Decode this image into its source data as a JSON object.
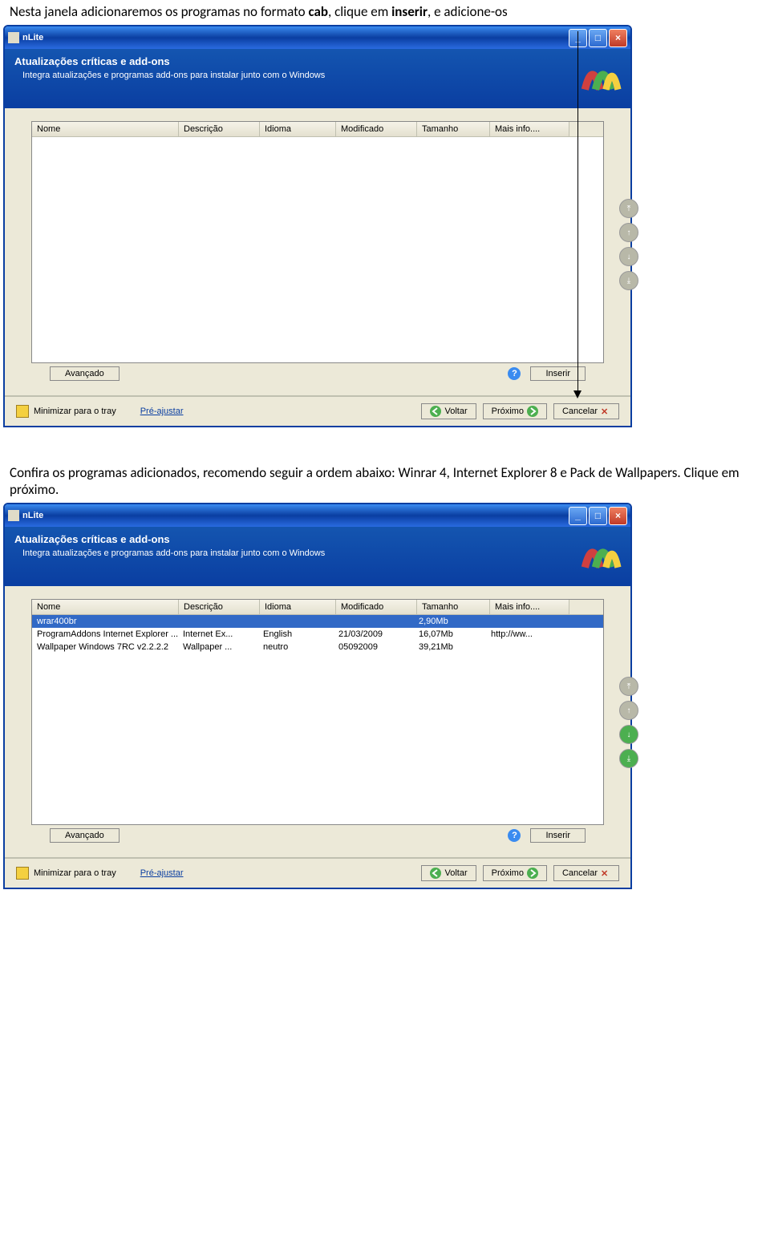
{
  "doc": {
    "intro_1a": "Nesta janela adicionaremos os programas no formato ",
    "intro_1b": "cab",
    "intro_1c": ", clique em ",
    "intro_1d": "inserir",
    "intro_1e": ", e adicione-os",
    "intro_2": "Confira os programas adicionados, recomendo seguir a ordem abaixo: Winrar 4, Internet Explorer 8 e Pack de Wallpapers. Clique em próximo."
  },
  "window": {
    "title": "nLite",
    "header_title": "Atualizações críticas e add-ons",
    "header_sub": "Integra atualizações e programas add-ons para instalar junto com o Windows",
    "cols": {
      "nome": "Nome",
      "desc": "Descrição",
      "idioma": "Idioma",
      "mod": "Modificado",
      "tam": "Tamanho",
      "mais": "Mais info...."
    },
    "buttons": {
      "avancado": "Avançado",
      "inserir": "Inserir",
      "voltar": "Voltar",
      "proximo": "Próximo",
      "cancelar": "Cancelar",
      "minimizar_tray": "Minimizar para o tray",
      "pre_ajustar": "Pré-ajustar"
    }
  },
  "rows": [
    {
      "nome": "wrar400br",
      "desc": "",
      "idioma": "",
      "mod": "",
      "tam": "2,90Mb",
      "mais": ""
    },
    {
      "nome": "ProgramAddons Internet Explorer ...",
      "desc": "Internet Ex...",
      "idioma": "English",
      "mod": "21/03/2009",
      "tam": "16,07Mb",
      "mais": "http://ww..."
    },
    {
      "nome": "Wallpaper Windows 7RC v2.2.2.2",
      "desc": "Wallpaper ...",
      "idioma": "neutro",
      "mod": "05092009",
      "tam": "39,21Mb",
      "mais": ""
    }
  ]
}
